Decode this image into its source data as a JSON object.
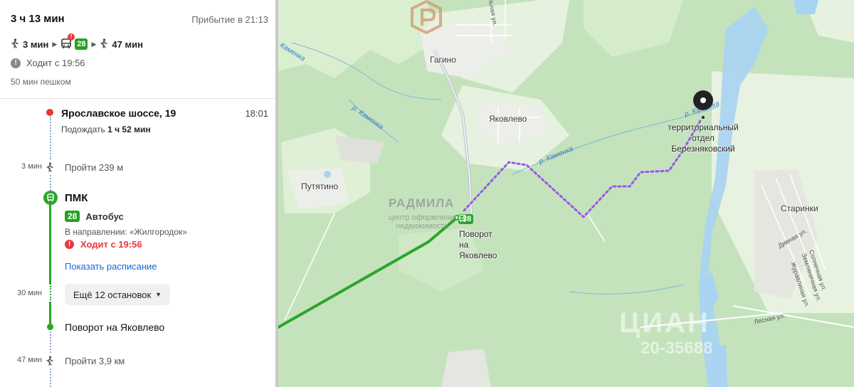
{
  "route": {
    "duration": "3 ч 13 мин",
    "arrival": "Прибытие в 21:13",
    "walk1": "3 мин",
    "bus_number": "28",
    "walk2": "47 мин",
    "runs_from": "Ходит с 19:56",
    "walking_alt": "50 мин пешком"
  },
  "steps": {
    "start_name": "Ярославское шоссе, 19",
    "start_time": "18:01",
    "wait_prefix": "Подождать",
    "wait_value": "1 ч 52 мин",
    "walk1_time": "3 мин",
    "walk1_text": "Пройти 239 м",
    "board_stop": "ПМК",
    "bus_number": "28",
    "bus_type": "Автобус",
    "direction": "В направлении: «Жилгородок»",
    "warning": "Ходит с 19:56",
    "schedule_link": "Показать расписание",
    "ride_time": "30 мин",
    "more_stops": "Ещё 12 остановок",
    "alight_stop": "Поворот на Яковлево",
    "walk2_time": "47 мин",
    "walk2_text": "Пройти 3,9 км"
  },
  "map": {
    "villages": {
      "gagino": "Гагино",
      "yakovlevo": "Яковлево",
      "putyatino": "Путятино",
      "starinki": "Старинки"
    },
    "rivers": {
      "r1": "Каменка",
      "r2": "р. Каменка",
      "r3": "р. Каменка",
      "r4": "р. Каменка"
    },
    "streets": {
      "s1": "льная ул.",
      "s2": "Дивная ул.",
      "s3": "Солнечная ул.",
      "s4": "Земляничная ул.",
      "s5": "Журавлиная ул.",
      "s6": "Лесная ул."
    },
    "destination_line1": "территориальный",
    "destination_line2": "отдел",
    "destination_line3": "Березняковский",
    "stop_line1": "Поворот",
    "stop_line2": "на",
    "stop_line3": "Яковлево",
    "bus_number": "28"
  },
  "watermarks": {
    "realtor_name": "РАДМИЛА",
    "realtor_sub1": "центр оформления",
    "realtor_sub2": "недвижимости",
    "cian": "ЦИАН",
    "cian_digits": "20-35688"
  },
  "colors": {
    "bus_green": "#2ba52b",
    "warning_red": "#e8383d",
    "link_blue": "#1b66d6",
    "walk_purple": "#9b59e6"
  }
}
